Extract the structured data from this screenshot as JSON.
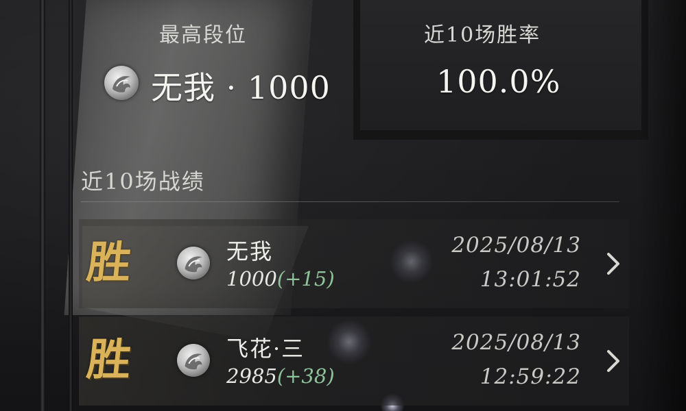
{
  "stats": {
    "highest_rank_label": "最高段位",
    "highest_rank_value": "无我 · 1000",
    "win_rate_label": "近10场胜率",
    "win_rate_value": "100.0%"
  },
  "recent_section": {
    "title": "近10场战绩"
  },
  "matches": [
    {
      "result": "胜",
      "rank_name": "无我",
      "score": "1000",
      "delta": "(+15)",
      "date": "2025/08/13",
      "time": "13:01:52"
    },
    {
      "result": "胜",
      "rank_name": "飞花·三",
      "score": "2985",
      "delta": "(+38)",
      "date": "2025/08/13",
      "time": "12:59:22"
    }
  ],
  "colors": {
    "win": "#d9b25a",
    "delta_positive": "#8fc39a",
    "text_primary": "#f4f4f0"
  },
  "icons": {
    "rank_emblem": "rank-emblem-icon",
    "chevron": "chevron-right-icon"
  }
}
